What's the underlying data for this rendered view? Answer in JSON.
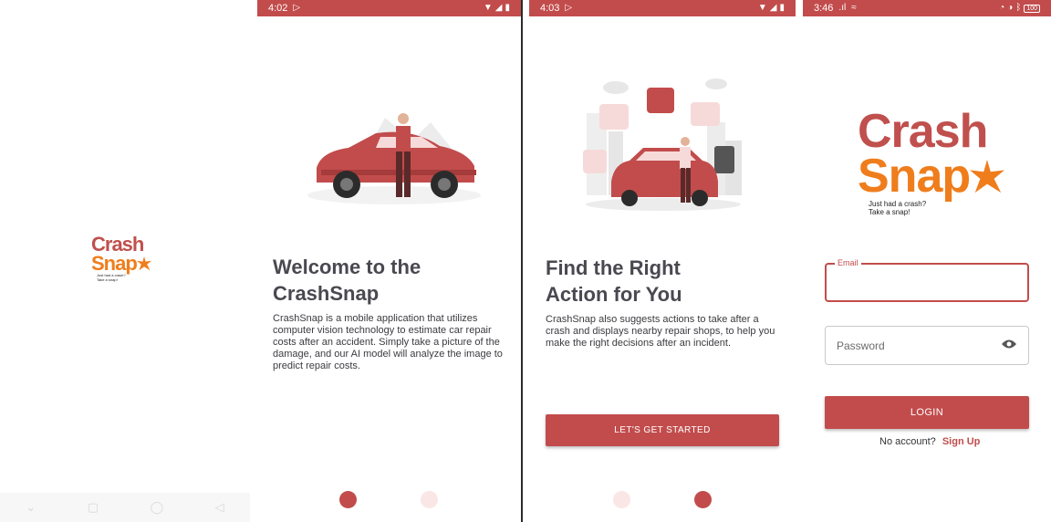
{
  "splash": {
    "logo_crash": "Crash",
    "logo_snap": "Snap",
    "tagline_line1": "Just had a crash?",
    "tagline_line2": "Take a snap!",
    "nav": {
      "down_icon": "chevron-down-icon",
      "home_icon": "circle-icon",
      "back_icon": "triangle-back-icon"
    }
  },
  "onboarding1": {
    "status_time": "4:02",
    "title_line1": "Welcome to the",
    "title_line2": "CrashSnap",
    "description": "CrashSnap is a mobile application that utilizes computer vision technology to estimate car repair costs after an accident. Simply take a picture of the damage, and our AI model will analyze the image to predict repair costs."
  },
  "onboarding2": {
    "status_time": "4:03",
    "title_line1": "Find the Right",
    "title_line2": "Action for You",
    "description": "CrashSnap also suggests actions to take after a crash and displays nearby repair shops, to help you make the right decisions after an incident.",
    "cta_label": "LET'S GET STARTED"
  },
  "login": {
    "status_time": "3:46",
    "status_right": "100",
    "logo_crash": "Crash",
    "logo_snap": "Snap",
    "tagline_line1": "Just had a crash?",
    "tagline_line2": "Take a snap!",
    "email_label": "Email",
    "password_placeholder": "Password",
    "login_label": "LOGIN",
    "no_account_text": "No account?",
    "signup_label": "Sign Up"
  },
  "colors": {
    "brand_red": "#c24c4c",
    "brand_orange": "#ef7d1c",
    "dot_inactive": "#fbe6e6"
  }
}
